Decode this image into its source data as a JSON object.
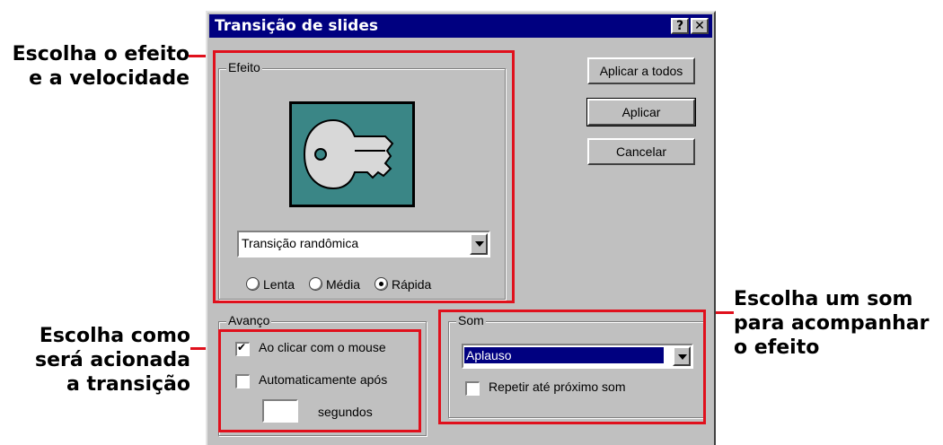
{
  "dialog": {
    "title": "Transição de slides",
    "help_glyph": "?",
    "close_glyph": "✕"
  },
  "effect": {
    "group_label": "Efeito",
    "combo_value": "Transição randômica",
    "radios": [
      {
        "label": "Lenta",
        "selected": false
      },
      {
        "label": "Média",
        "selected": false
      },
      {
        "label": "Rápida",
        "selected": true
      }
    ]
  },
  "buttons": {
    "apply_all": "Aplicar a todos",
    "apply": "Aplicar",
    "cancel": "Cancelar"
  },
  "advance": {
    "group_label": "Avanço",
    "on_click_label": "Ao clicar com o mouse",
    "on_click_checked": true,
    "auto_label": "Automaticamente após",
    "auto_checked": false,
    "seconds_value": "",
    "seconds_label": "segundos"
  },
  "sound": {
    "group_label": "Som",
    "combo_value": "Aplauso",
    "loop_label": "Repetir até próximo som",
    "loop_checked": false
  },
  "callouts": {
    "effect": "Escolha o efeito\ne a velocidade",
    "advance": "Escolha como\nserá acionada\na transição",
    "sound": "Escolha um som\npara acompanhar\no efeito"
  },
  "colors": {
    "title_bar": "#000080",
    "callout_red": "#e0101c",
    "selection": "#000080"
  }
}
